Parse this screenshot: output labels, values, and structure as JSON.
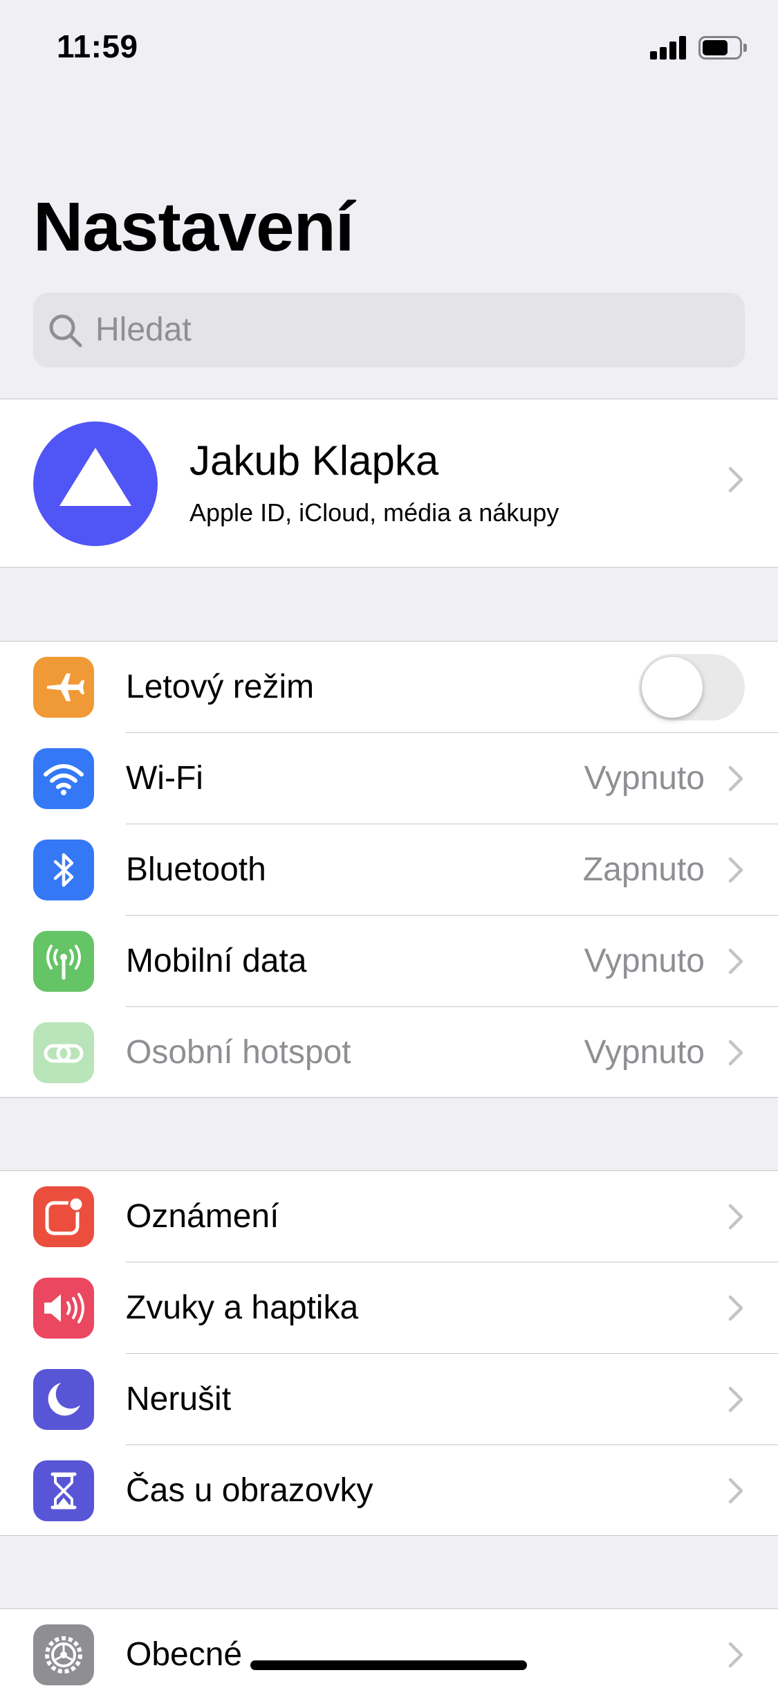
{
  "status_bar": {
    "time": "11:59",
    "signal_icon": "cellular-signal-icon",
    "battery_icon": "battery-icon"
  },
  "header": {
    "title": "Nastavení"
  },
  "search": {
    "placeholder": "Hledat",
    "icon": "search-icon"
  },
  "profile": {
    "name": "Jakub Klapka",
    "subtitle": "Apple ID, iCloud, média a nákupy",
    "avatar_color": "#5055f5"
  },
  "connectivity": [
    {
      "label": "Letový režim",
      "icon": "airplane-icon",
      "color": "#f09a37",
      "toggle": false
    },
    {
      "label": "Wi-Fi",
      "value": "Vypnuto",
      "icon": "wifi-icon",
      "color": "#3478f6"
    },
    {
      "label": "Bluetooth",
      "value": "Zapnuto",
      "icon": "bluetooth-icon",
      "color": "#3478f6"
    },
    {
      "label": "Mobilní data",
      "value": "Vypnuto",
      "icon": "cellular-antenna-icon",
      "color": "#65c466"
    },
    {
      "label": "Osobní hotspot",
      "value": "Vypnuto",
      "icon": "hotspot-icon",
      "color": "#65c466",
      "disabled": true
    }
  ],
  "notifications": [
    {
      "label": "Oznámení",
      "icon": "notifications-icon",
      "color": "#eb4e3d"
    },
    {
      "label": "Zvuky a haptika",
      "icon": "speaker-icon",
      "color": "#eb4760"
    },
    {
      "label": "Nerušit",
      "icon": "moon-icon",
      "color": "#5856d6"
    },
    {
      "label": "Čas u obrazovky",
      "icon": "hourglass-icon",
      "color": "#5856d6"
    }
  ],
  "general": [
    {
      "label": "Obecné",
      "icon": "gear-icon",
      "color": "#8e8e93"
    }
  ]
}
